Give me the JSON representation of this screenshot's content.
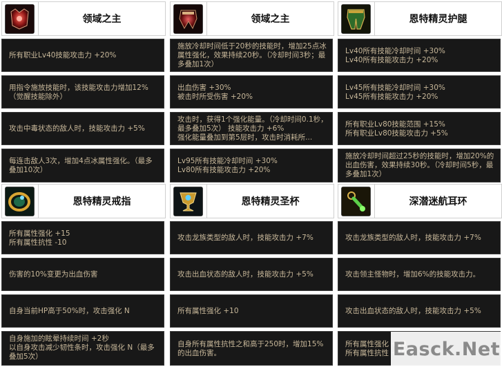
{
  "colors": {
    "cell_bg": "#181818",
    "cell_text": "#c8b89a",
    "header_bg": "#ffffff"
  },
  "items": [
    {
      "name": "领域之主",
      "icon": "red-armor-top-icon",
      "effects": [
        "所有职业Lv40技能攻击力 +20%",
        "用指令施放技能时，该技能攻击力增加12%（觉醒技能除外）",
        "攻击中毒状态的敌人时，技能攻击力 +5%",
        "每连击敌人3次，增加4点冰属性强化。（最多叠加10次）"
      ]
    },
    {
      "name": "领域之主",
      "icon": "red-armor-bottom-icon",
      "effects": [
        "施放冷却时间低于20秒的技能时，增加25点冰属性强化，效果持续20秒。（冷却时间3秒；最多叠加1次）",
        "出血伤害 +30%\n被击时所受伤害 +20%",
        "攻击时，获得1个强化能量。（冷却时间0.1秒，最多叠加5次）        技能攻击力 +6%\n强化能量叠加到第5层时，攻击时消耗所...",
        "Lv95所有技能冷却时间 +30%\nLv80所有技能攻击力 +20%"
      ]
    },
    {
      "name": "恩特精灵护腿",
      "icon": "green-leggings-icon",
      "effects": [
        "Lv40所有技能冷却时间 +30%\nLv40所有技能攻击力 +20%",
        "Lv45所有技能冷却时间 +30%\nLv45所有技能攻击力 +20%",
        "所有职业Lv80技能范围 +15%\n所有职业Lv80技能攻击力 +5%",
        "施放冷却时间超过25秒的技能时，增加20%的出血伤害，效果持续30秒。（冷却时间5秒，最多叠加1次）"
      ]
    },
    {
      "name": "恩特精灵戒指",
      "icon": "gold-ring-icon",
      "effects": [
        "所有属性强化 +15\n所有属性抗性 -10",
        "伤害的10%变更为出血伤害",
        "自身当前HP高于50%时，攻击强化 N",
        "自身施加的眩晕持续时间 +2秒\n以自身攻击减少韧性条时，攻击强化 N（最多叠加5次）"
      ]
    },
    {
      "name": "恩特精灵圣杯",
      "icon": "grail-icon",
      "effects": [
        "攻击龙族类型的敌人时，技能攻击力 +7%",
        "攻击出血状态的敌人时，技能攻击力 +5%",
        "所有属性强化 +10",
        "自身所有属性抗性之和高于250时，增加15%的出血伤害。"
      ]
    },
    {
      "name": "深潜迷航耳环",
      "icon": "green-earring-icon",
      "effects": [
        "攻击龙族类型的敌人时，技能攻击力 +7%",
        "攻击领主怪物时，增加6%的技能攻击力。",
        "攻击出血状态的敌人时，技能攻击力 +5%",
        "所有属性强化 +10\n所有属性抗性 +10"
      ]
    }
  ],
  "watermark": "Easck.Net"
}
